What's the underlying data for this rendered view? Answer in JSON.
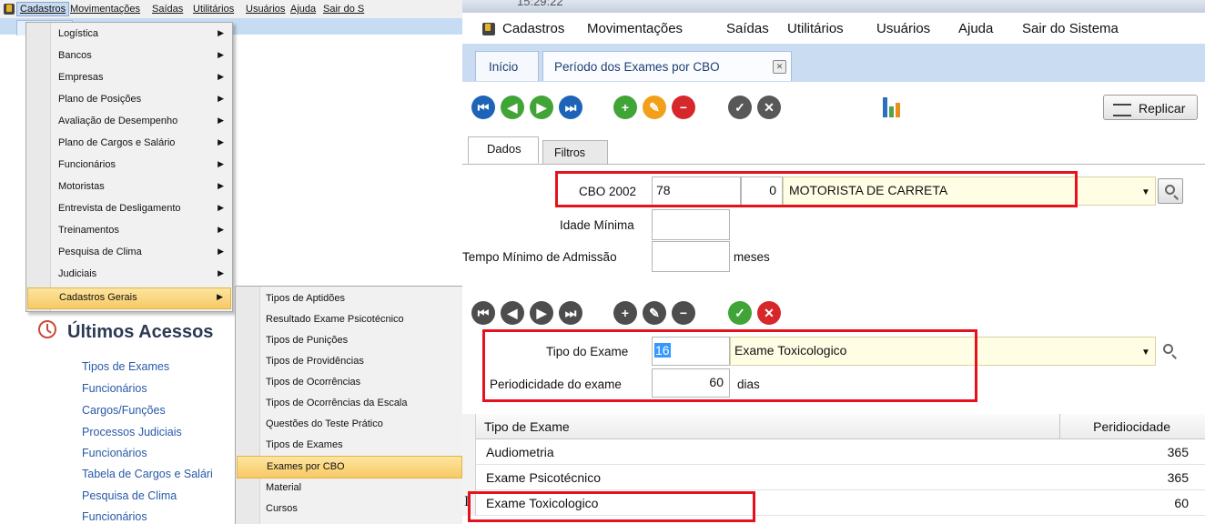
{
  "left": {
    "menubar": [
      "Cadastros",
      "Movimentações",
      "Saídas",
      "Utilitários",
      "Usuários",
      "Ajuda",
      "Sair do S"
    ],
    "cadastros_menu": [
      "Logística",
      "Bancos",
      "Empresas",
      "Plano de Posições",
      "Avaliação de Desempenho",
      "Plano de Cargos e Salário",
      "Funcionários",
      "Motoristas",
      "Entrevista de Desligamento",
      "Treinamentos",
      "Pesquisa de Clima",
      "Judiciais",
      "Cadastros Gerais"
    ],
    "cadastros_gerais_menu": [
      "Tipos de Aptidões",
      "Resultado Exame Psicotécnico",
      "Tipos de Punições",
      "Tipos de Providências",
      "Tipos de Ocorrências",
      "Tipos de Ocorrências da Escala",
      "Questões do Teste Prático",
      "Tipos de Exames",
      "Exames por CBO",
      "Material",
      "Cursos"
    ],
    "recent_title": "Últimos Acessos",
    "recent_items": [
      "Tipos de Exames",
      "Funcionários",
      "Cargos/Funções",
      "Processos Judiciais",
      "Funcionários",
      "Tabela de Cargos e Salári",
      "Pesquisa de Clima",
      "Funcionários"
    ]
  },
  "right": {
    "title_partial": "15:29:22",
    "menubar": [
      "Cadastros",
      "Movimentações",
      "Saídas",
      "Utilitários",
      "Usuários",
      "Ajuda",
      "Sair do Sistema"
    ],
    "tabs": [
      "Início",
      "Período dos Exames por CBO"
    ],
    "replicar_label": "Replicar",
    "inner_tabs": [
      "Dados",
      "Filtros"
    ],
    "form": {
      "cbo_label": "CBO 2002",
      "cbo_code": "78",
      "cbo_num": "0",
      "cbo_desc": "MOTORISTA DE CARRETA",
      "idade_label": "Idade Mínima",
      "idade_value": "",
      "tempo_label": "Tempo Mínimo de Admissão",
      "tempo_value": "",
      "tempo_unit": "meses"
    },
    "detail": {
      "tipo_label": "Tipo do Exame",
      "tipo_code": "16",
      "tipo_desc": "Exame Toxicologico",
      "period_label": "Periodicidade do exame",
      "period_value": "60",
      "period_unit": "dias"
    },
    "grid": {
      "headers": [
        "Tipo de Exame",
        "Peridiocidade"
      ],
      "rows": [
        {
          "tipo": "Audiometria",
          "periodo": "365"
        },
        {
          "tipo": "Exame Psicotécnico",
          "periodo": "365"
        },
        {
          "tipo": "Exame Toxicologico",
          "periodo": "60"
        }
      ]
    }
  },
  "colors": {
    "highlight_box": "#e5121c",
    "menu_highlight": "#f7c964",
    "link": "#2859a8"
  }
}
